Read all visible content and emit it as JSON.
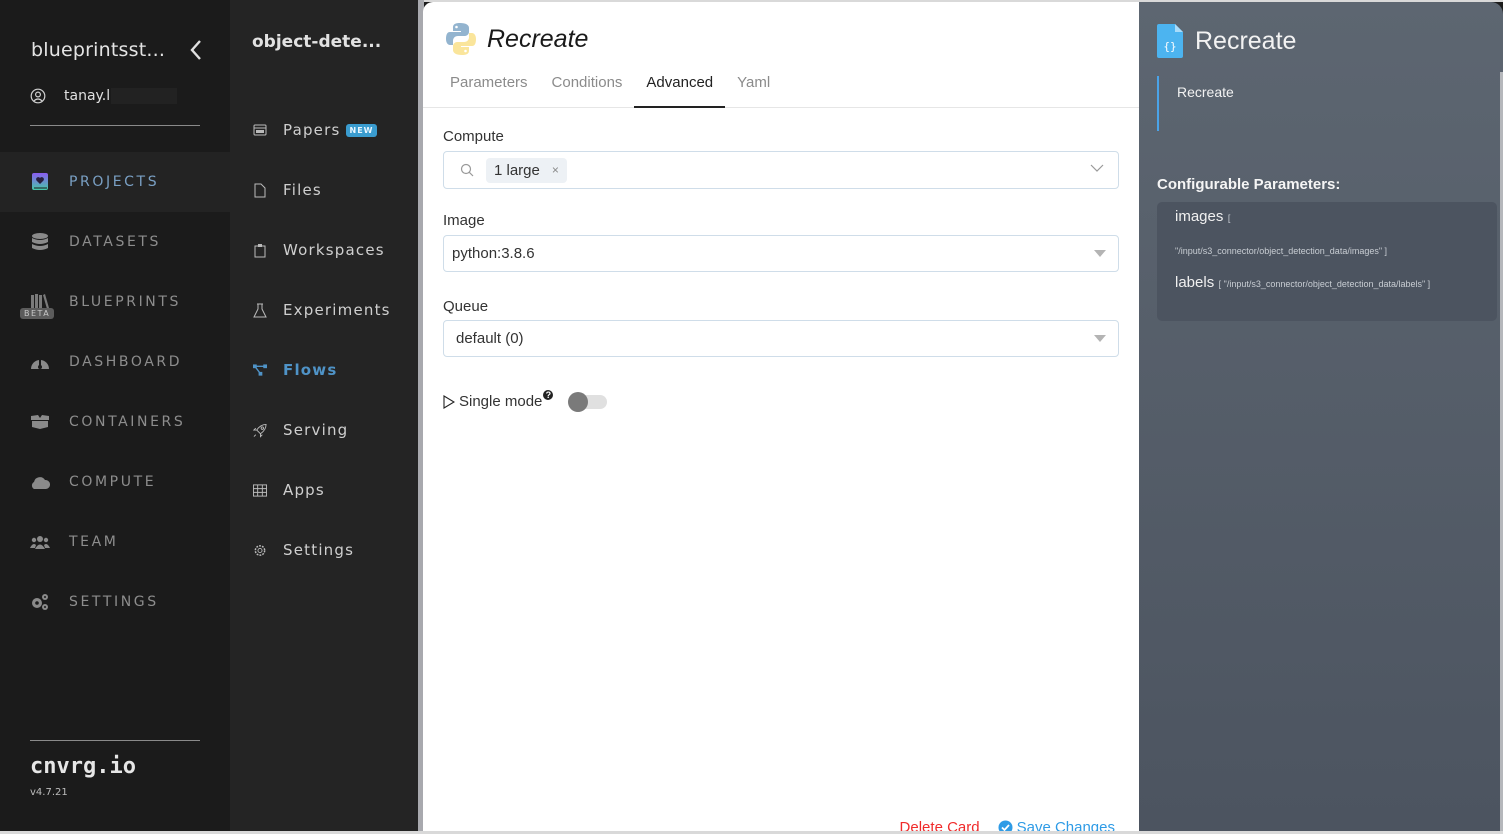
{
  "main_sidebar": {
    "org_name": "blueprintsst...",
    "user_name": "tanay.l",
    "nav": [
      {
        "label": "PROJECTS",
        "icon": "projects-icon",
        "active": true
      },
      {
        "label": "DATASETS",
        "icon": "database-icon"
      },
      {
        "label": "BLUEPRINTS",
        "icon": "books-icon",
        "badge": "BETA"
      },
      {
        "label": "DASHBOARD",
        "icon": "gauge-icon"
      },
      {
        "label": "CONTAINERS",
        "icon": "box-icon"
      },
      {
        "label": "COMPUTE",
        "icon": "cloud-icon"
      },
      {
        "label": "TEAM",
        "icon": "team-icon"
      },
      {
        "label": "SETTINGS",
        "icon": "gears-icon"
      }
    ],
    "brand": "cnvrg.io",
    "version": "v4.7.21"
  },
  "project_sidebar": {
    "title": "object-dete...",
    "items": [
      {
        "label": "Papers",
        "icon": "papers-icon",
        "badge": "NEW"
      },
      {
        "label": "Files",
        "icon": "file-icon"
      },
      {
        "label": "Workspaces",
        "icon": "clipboard-icon"
      },
      {
        "label": "Experiments",
        "icon": "flask-icon"
      },
      {
        "label": "Flows",
        "icon": "flows-icon",
        "active": true
      },
      {
        "label": "Serving",
        "icon": "rocket-icon"
      },
      {
        "label": "Apps",
        "icon": "grid-icon"
      },
      {
        "label": "Settings",
        "icon": "gear-icon"
      }
    ]
  },
  "edit_panel": {
    "title": "Recreate",
    "tabs": [
      "Parameters",
      "Conditions",
      "Advanced",
      "Yaml"
    ],
    "active_tab": "Advanced",
    "compute": {
      "label": "Compute",
      "tags": [
        "1 large"
      ],
      "remove_glyph": "×"
    },
    "image": {
      "label": "Image",
      "value": "python:3.8.6"
    },
    "queue": {
      "label": "Queue",
      "value": "default (0)"
    },
    "single_mode": {
      "label": "Single mode",
      "help": "?",
      "enabled": false
    },
    "delete_label": "Delete Card",
    "save_label": "Save Changes",
    "colors": {
      "delete": "#f02a2a",
      "save": "#2e9be6"
    }
  },
  "info_panel": {
    "title": "Recreate",
    "description": "Recreate",
    "config_title": "Configurable Parameters:",
    "params": [
      {
        "name": "images",
        "open": "[",
        "value": "\"/input/s3_connector/object_detection_data/images\" ]"
      },
      {
        "name": "labels",
        "value": "[ \"/input/s3_connector/object_detection_data/labels\" ]"
      }
    ]
  }
}
